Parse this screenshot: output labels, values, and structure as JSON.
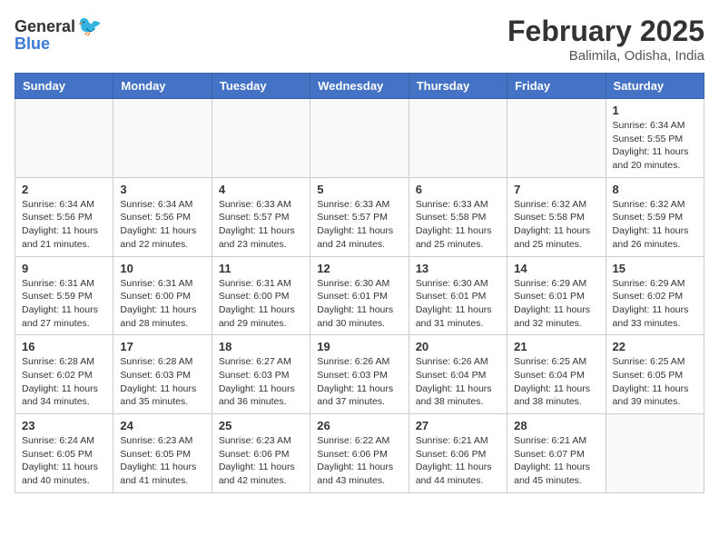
{
  "header": {
    "logo_general": "General",
    "logo_blue": "Blue",
    "month": "February 2025",
    "location": "Balimila, Odisha, India"
  },
  "weekdays": [
    "Sunday",
    "Monday",
    "Tuesday",
    "Wednesday",
    "Thursday",
    "Friday",
    "Saturday"
  ],
  "weeks": [
    [
      {
        "day": "",
        "info": ""
      },
      {
        "day": "",
        "info": ""
      },
      {
        "day": "",
        "info": ""
      },
      {
        "day": "",
        "info": ""
      },
      {
        "day": "",
        "info": ""
      },
      {
        "day": "",
        "info": ""
      },
      {
        "day": "1",
        "info": "Sunrise: 6:34 AM\nSunset: 5:55 PM\nDaylight: 11 hours\nand 20 minutes."
      }
    ],
    [
      {
        "day": "2",
        "info": "Sunrise: 6:34 AM\nSunset: 5:56 PM\nDaylight: 11 hours\nand 21 minutes."
      },
      {
        "day": "3",
        "info": "Sunrise: 6:34 AM\nSunset: 5:56 PM\nDaylight: 11 hours\nand 22 minutes."
      },
      {
        "day": "4",
        "info": "Sunrise: 6:33 AM\nSunset: 5:57 PM\nDaylight: 11 hours\nand 23 minutes."
      },
      {
        "day": "5",
        "info": "Sunrise: 6:33 AM\nSunset: 5:57 PM\nDaylight: 11 hours\nand 24 minutes."
      },
      {
        "day": "6",
        "info": "Sunrise: 6:33 AM\nSunset: 5:58 PM\nDaylight: 11 hours\nand 25 minutes."
      },
      {
        "day": "7",
        "info": "Sunrise: 6:32 AM\nSunset: 5:58 PM\nDaylight: 11 hours\nand 25 minutes."
      },
      {
        "day": "8",
        "info": "Sunrise: 6:32 AM\nSunset: 5:59 PM\nDaylight: 11 hours\nand 26 minutes."
      }
    ],
    [
      {
        "day": "9",
        "info": "Sunrise: 6:31 AM\nSunset: 5:59 PM\nDaylight: 11 hours\nand 27 minutes."
      },
      {
        "day": "10",
        "info": "Sunrise: 6:31 AM\nSunset: 6:00 PM\nDaylight: 11 hours\nand 28 minutes."
      },
      {
        "day": "11",
        "info": "Sunrise: 6:31 AM\nSunset: 6:00 PM\nDaylight: 11 hours\nand 29 minutes."
      },
      {
        "day": "12",
        "info": "Sunrise: 6:30 AM\nSunset: 6:01 PM\nDaylight: 11 hours\nand 30 minutes."
      },
      {
        "day": "13",
        "info": "Sunrise: 6:30 AM\nSunset: 6:01 PM\nDaylight: 11 hours\nand 31 minutes."
      },
      {
        "day": "14",
        "info": "Sunrise: 6:29 AM\nSunset: 6:01 PM\nDaylight: 11 hours\nand 32 minutes."
      },
      {
        "day": "15",
        "info": "Sunrise: 6:29 AM\nSunset: 6:02 PM\nDaylight: 11 hours\nand 33 minutes."
      }
    ],
    [
      {
        "day": "16",
        "info": "Sunrise: 6:28 AM\nSunset: 6:02 PM\nDaylight: 11 hours\nand 34 minutes."
      },
      {
        "day": "17",
        "info": "Sunrise: 6:28 AM\nSunset: 6:03 PM\nDaylight: 11 hours\nand 35 minutes."
      },
      {
        "day": "18",
        "info": "Sunrise: 6:27 AM\nSunset: 6:03 PM\nDaylight: 11 hours\nand 36 minutes."
      },
      {
        "day": "19",
        "info": "Sunrise: 6:26 AM\nSunset: 6:03 PM\nDaylight: 11 hours\nand 37 minutes."
      },
      {
        "day": "20",
        "info": "Sunrise: 6:26 AM\nSunset: 6:04 PM\nDaylight: 11 hours\nand 38 minutes."
      },
      {
        "day": "21",
        "info": "Sunrise: 6:25 AM\nSunset: 6:04 PM\nDaylight: 11 hours\nand 38 minutes."
      },
      {
        "day": "22",
        "info": "Sunrise: 6:25 AM\nSunset: 6:05 PM\nDaylight: 11 hours\nand 39 minutes."
      }
    ],
    [
      {
        "day": "23",
        "info": "Sunrise: 6:24 AM\nSunset: 6:05 PM\nDaylight: 11 hours\nand 40 minutes."
      },
      {
        "day": "24",
        "info": "Sunrise: 6:23 AM\nSunset: 6:05 PM\nDaylight: 11 hours\nand 41 minutes."
      },
      {
        "day": "25",
        "info": "Sunrise: 6:23 AM\nSunset: 6:06 PM\nDaylight: 11 hours\nand 42 minutes."
      },
      {
        "day": "26",
        "info": "Sunrise: 6:22 AM\nSunset: 6:06 PM\nDaylight: 11 hours\nand 43 minutes."
      },
      {
        "day": "27",
        "info": "Sunrise: 6:21 AM\nSunset: 6:06 PM\nDaylight: 11 hours\nand 44 minutes."
      },
      {
        "day": "28",
        "info": "Sunrise: 6:21 AM\nSunset: 6:07 PM\nDaylight: 11 hours\nand 45 minutes."
      },
      {
        "day": "",
        "info": ""
      }
    ]
  ]
}
